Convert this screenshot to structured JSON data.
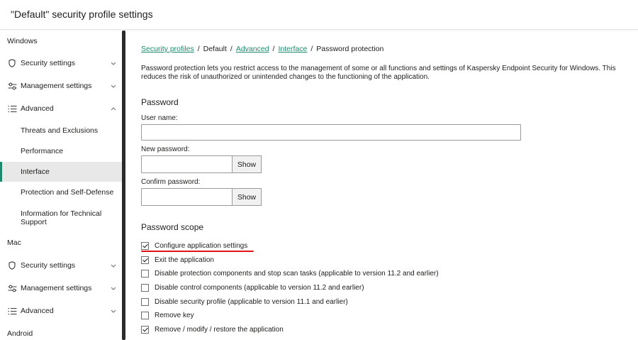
{
  "header": {
    "title": "\"Default\" security profile settings"
  },
  "sidebar": {
    "groups": [
      {
        "label": "Windows"
      },
      {
        "label": "Mac"
      },
      {
        "label": "Android"
      }
    ],
    "windows_items": [
      {
        "label": "Security settings",
        "icon": "shield-icon"
      },
      {
        "label": "Management settings",
        "icon": "sliders-icon"
      },
      {
        "label": "Advanced",
        "icon": "list-icon"
      }
    ],
    "advanced_subitems": [
      {
        "label": "Threats and Exclusions"
      },
      {
        "label": "Performance"
      },
      {
        "label": "Interface",
        "active": true
      },
      {
        "label": "Protection and Self-Defense"
      },
      {
        "label": "Information for Technical Support"
      }
    ],
    "mac_items": [
      {
        "label": "Security settings",
        "icon": "shield-icon"
      },
      {
        "label": "Management settings",
        "icon": "sliders-icon"
      },
      {
        "label": "Advanced",
        "icon": "list-icon"
      }
    ]
  },
  "breadcrumb": {
    "items": [
      {
        "label": "Security profiles",
        "link": true
      },
      {
        "label": "Default",
        "link": false
      },
      {
        "label": "Advanced",
        "link": true
      },
      {
        "label": "Interface",
        "link": true
      },
      {
        "label": "Password protection",
        "link": false
      }
    ],
    "separator": "/"
  },
  "description": "Password protection lets you restrict access to the management of some or all functions and settings of Kaspersky Endpoint Security for Windows. This reduces the risk of unauthorized or unintended changes to the functioning of the application.",
  "password": {
    "title": "Password",
    "user_name_label": "User name:",
    "user_name_value": "",
    "new_password_label": "New password:",
    "new_password_value": "",
    "confirm_password_label": "Confirm password:",
    "confirm_password_value": "",
    "show_label": "Show"
  },
  "scope": {
    "title": "Password scope",
    "items": [
      {
        "label": "Configure application settings",
        "checked": true
      },
      {
        "label": "Exit the application",
        "checked": true
      },
      {
        "label": "Disable protection components and stop scan tasks (applicable to version 11.2 and earlier)",
        "checked": false
      },
      {
        "label": "Disable control components (applicable to version 11.2 and earlier)",
        "checked": false
      },
      {
        "label": "Disable security profile (applicable to version 11.1 and earlier)",
        "checked": false
      },
      {
        "label": "Remove key",
        "checked": false
      },
      {
        "label": "Remove / modify / restore the application",
        "checked": true
      }
    ]
  },
  "colors": {
    "accent": "#1d8a6e",
    "highlight_underline": "#e0121c"
  }
}
